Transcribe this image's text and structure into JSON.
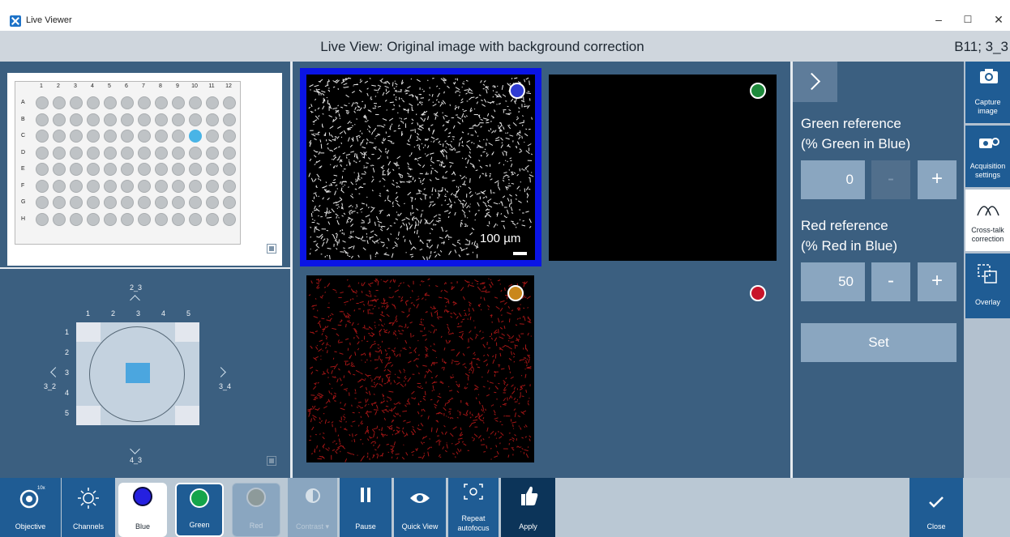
{
  "window": {
    "title": "Live Viewer",
    "min_symbol": "–",
    "max_symbol": "☐",
    "close_symbol": "✕"
  },
  "header": {
    "title": "Live View: Original image with background correction",
    "position": "B11; 3_3"
  },
  "plate": {
    "columns": [
      "1",
      "2",
      "3",
      "4",
      "5",
      "6",
      "7",
      "8",
      "9",
      "10",
      "11",
      "12"
    ],
    "rows": [
      "A",
      "B",
      "C",
      "D",
      "E",
      "F",
      "G",
      "H"
    ],
    "selected_well": "C10",
    "selected_color": "#49b4e6"
  },
  "field": {
    "columns": [
      "1",
      "2",
      "3",
      "4",
      "5"
    ],
    "rows": [
      "1",
      "2",
      "3",
      "4",
      "5"
    ],
    "nav_up": "2_3",
    "nav_down": "4_3",
    "nav_left": "3_2",
    "nav_right": "3_4"
  },
  "image_tiles": {
    "scale_bar_label": "100 µm",
    "blue_channel_color": "#2e3bd1",
    "green_channel_color": "#1e8a3c",
    "red_channel_color": "#c8142a",
    "orange_channel_color": "#c9871c",
    "frame_color": "#0a14e5"
  },
  "settings": {
    "green_ref_line1": "Green reference",
    "green_ref_line2": "(% Green in Blue)",
    "green_value": "0",
    "red_ref_line1": "Red reference",
    "red_ref_line2": "(% Red in Blue)",
    "red_value": "50",
    "minus_label": "-",
    "plus_label": "+",
    "set_label": "Set"
  },
  "tools": {
    "capture_line1": "Capture",
    "capture_line2": "image",
    "acq_line1": "Acquisition",
    "acq_line2": "settings",
    "crosstalk_line1": "Cross-talk",
    "crosstalk_line2": "correction",
    "overlay": "Overlay"
  },
  "toolbar": {
    "objective": "Objective",
    "objective_mag": "10x",
    "channels": "Channels",
    "blue": "Blue",
    "green": "Green",
    "red": "Red",
    "contrast": "Contrast ▾",
    "pause": "Pause",
    "quick_view": "Quick View",
    "repeat_line1": "Repeat",
    "repeat_line2": "autofocus",
    "apply": "Apply",
    "close": "Close"
  }
}
